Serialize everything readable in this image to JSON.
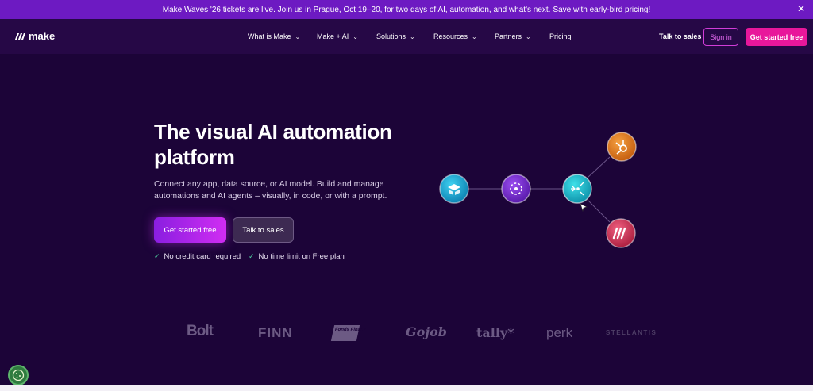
{
  "announcement": {
    "text": "Make Waves '26 tickets are live. Join us in Prague, Oct 19–20, for two days of AI, automation, and what's next.",
    "link": "Save with early-bird pricing!",
    "close": "✕"
  },
  "nav": {
    "logo": "make",
    "items": [
      {
        "label": "What is Make",
        "chevron": true
      },
      {
        "label": "Make + AI",
        "chevron": true
      },
      {
        "label": "Solutions",
        "chevron": true
      },
      {
        "label": "Resources",
        "chevron": true
      },
      {
        "label": "Partners",
        "chevron": true
      },
      {
        "label": "Pricing",
        "chevron": false
      }
    ],
    "talk_to_sales": "Talk to sales",
    "sign_in": "Sign in",
    "get_started": "Get started free"
  },
  "hero": {
    "title": "The visual AI automation platform",
    "description": "Connect any app, data source, or AI model. Build and manage automations and AI agents – visually, in code, or with a prompt.",
    "primary_button": "Get started free",
    "secondary_button": "Talk to sales",
    "checks": [
      "No credit card required",
      "No time limit on Free plan"
    ]
  },
  "diagram": {
    "nodes": [
      {
        "name": "airtable-icon",
        "color": "#1ba7d6"
      },
      {
        "name": "ai-agent-icon",
        "color": "#7b2ed6"
      },
      {
        "name": "router-icon",
        "color": "#19b5c9"
      },
      {
        "name": "hubspot-icon",
        "color": "#e8781a"
      },
      {
        "name": "make-icon",
        "color": "#d83a5a"
      }
    ]
  },
  "logos": [
    "Bolt",
    "FINN",
    "Fonds Finanz",
    "Gojob",
    "tally*",
    "perk",
    "STELLANTIS"
  ],
  "colors": {
    "background": "#1c0438",
    "announcement": "#6d1ac2",
    "accent_pink": "#e8179b",
    "accent_purple": "#d02df2"
  }
}
